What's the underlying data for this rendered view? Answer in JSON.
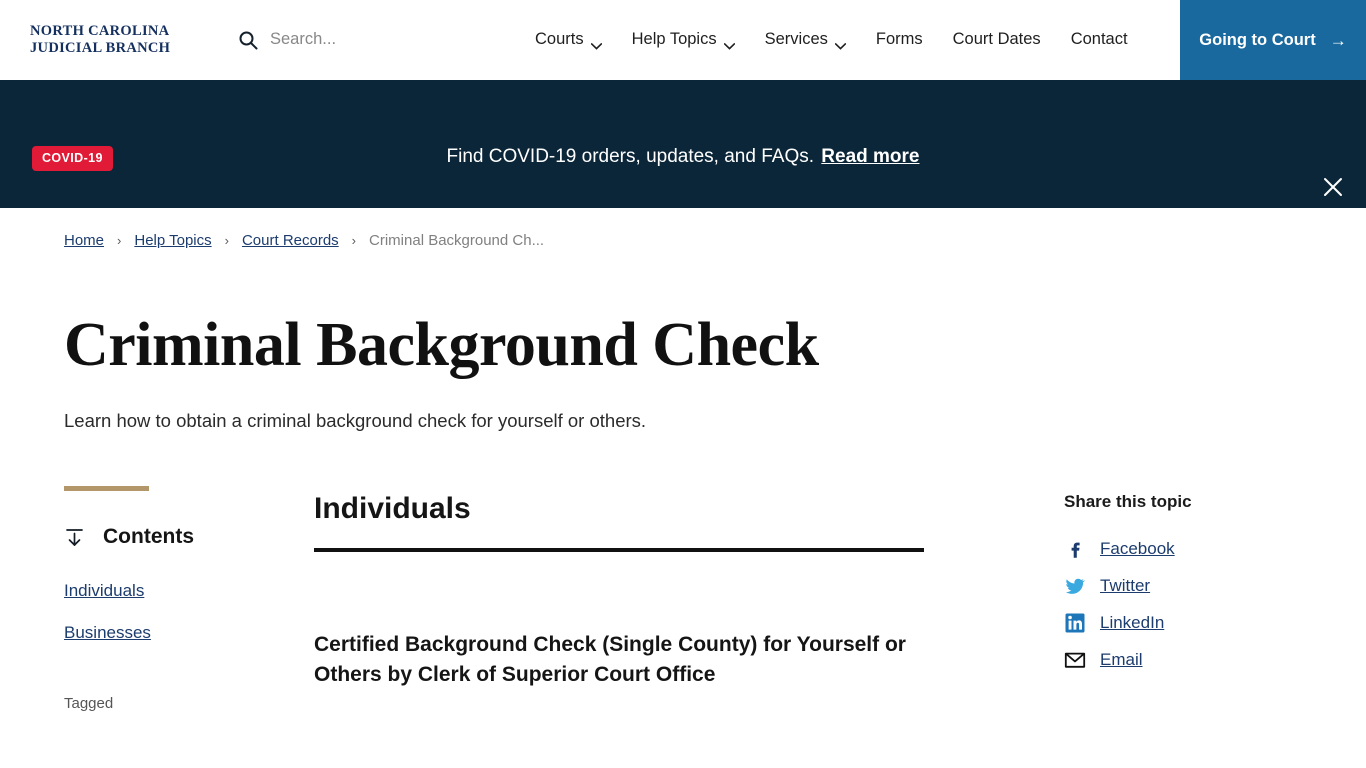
{
  "header": {
    "logo_line1": "NORTH CAROLINA",
    "logo_line2": "JUDICIAL BRANCH",
    "search_placeholder": "Search...",
    "search_value": "",
    "nav": [
      {
        "label": "Courts",
        "has_caret": true
      },
      {
        "label": "Help Topics",
        "has_caret": true
      },
      {
        "label": "Services",
        "has_caret": true
      },
      {
        "label": "Forms",
        "has_caret": false
      },
      {
        "label": "Court Dates",
        "has_caret": false
      },
      {
        "label": "Contact",
        "has_caret": false
      }
    ],
    "cta_label": "Going to Court",
    "cta_arrow": "→",
    "cta_color": "#19699e"
  },
  "banner": {
    "badge": "COVID-19",
    "badge_color": "#e01a37",
    "background": "#0b2639",
    "message": "Find COVID-19 orders, updates, and FAQs.",
    "link_label": "Read more",
    "close_label": "×"
  },
  "breadcrumb": {
    "separator": "›",
    "items": [
      {
        "label": "Home",
        "current": false
      },
      {
        "label": "Help Topics",
        "current": false
      },
      {
        "label": "Court Records",
        "current": false
      },
      {
        "label": "Criminal Background Ch...",
        "current": true
      }
    ]
  },
  "page": {
    "title": "Criminal Background Check",
    "subtitle": "Learn how to obtain a criminal background check for yourself or others.",
    "accent_color": "#b3966a"
  },
  "contents": {
    "title": "Contents",
    "icon": "jump-to-icon",
    "links": [
      {
        "label": "Individuals"
      },
      {
        "label": "Businesses"
      }
    ],
    "tagged_label": "Tagged"
  },
  "main": {
    "section_heading": "Individuals",
    "subsection_heading": "Certified Background Check (Single County) for Yourself or Others by Clerk of Superior Court Office"
  },
  "share": {
    "title": "Share this topic",
    "items": [
      {
        "label": "Facebook",
        "icon": "facebook-icon",
        "color": "#1c3c6e"
      },
      {
        "label": "Twitter",
        "icon": "twitter-icon",
        "color": "#3aa9e0"
      },
      {
        "label": "LinkedIn",
        "icon": "linkedin-icon",
        "color": "#1c76b8"
      },
      {
        "label": "Email",
        "icon": "email-icon",
        "color": "#111111"
      }
    ]
  }
}
